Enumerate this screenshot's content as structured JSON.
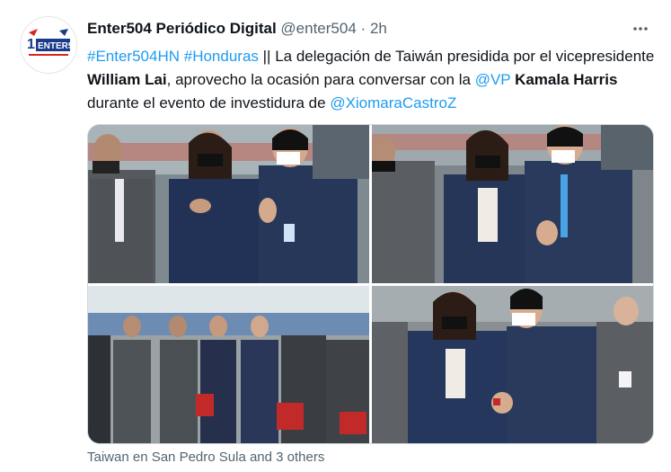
{
  "tweet": {
    "display_name": "Enter504 Periódico Digital",
    "handle": "@enter504",
    "separator": "·",
    "time": "2h",
    "more_icon": "more-horizontal-icon",
    "avatar_logo_text": "ENTER504",
    "avatar_logo_number": "1",
    "text": {
      "hashtag1": "#Enter504HN",
      "hashtag2": "#Honduras",
      "part1": " || La delegación de Taiwán presidida por el vicepresidente ",
      "bold1": "William Lai",
      "part2": ", aprovecho la ocasión para conversar con la ",
      "mention1": "@VP",
      "bold2": "Kamala Harris",
      "part3": " durante el evento de investidura de ",
      "mention2": "@XiomaraCastroZ"
    },
    "location": "Taiwan en San Pedro Sula and 3 others"
  },
  "colors": {
    "link": "#1d9bf0",
    "secondary_text": "#536471",
    "primary_text": "#0f1419"
  }
}
